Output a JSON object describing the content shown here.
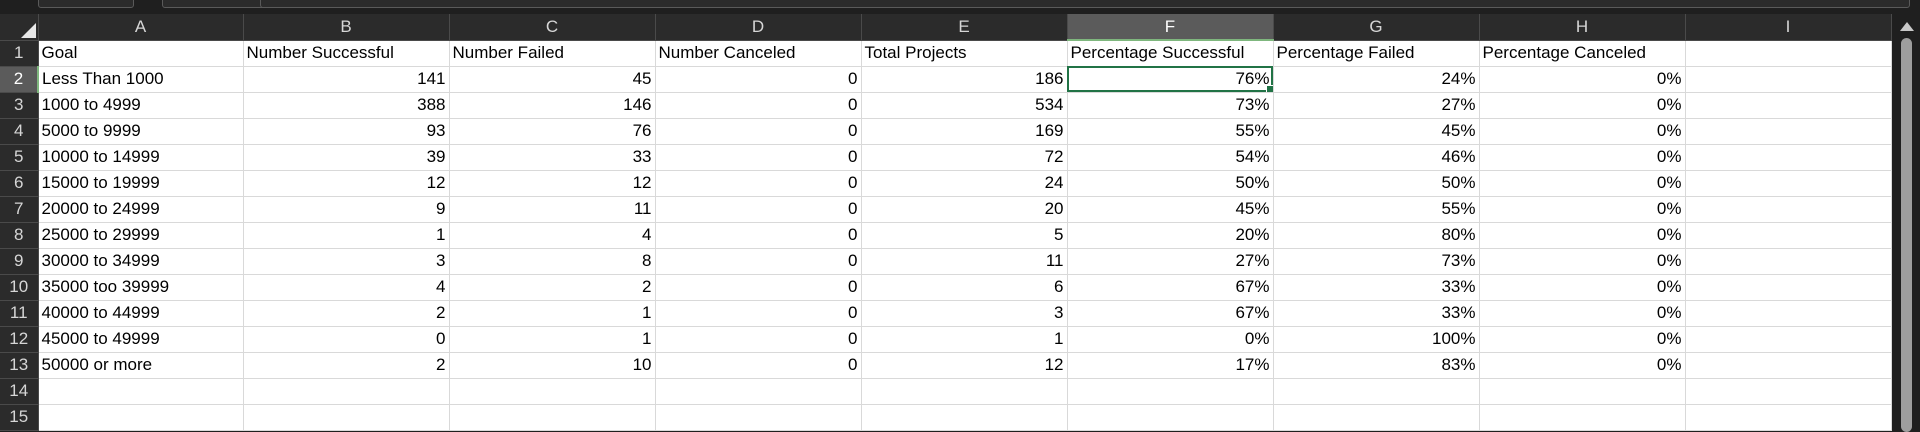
{
  "columns": [
    "A",
    "B",
    "C",
    "D",
    "E",
    "F",
    "G",
    "H",
    "I"
  ],
  "active_column": "F",
  "active_row": "2",
  "rows": [
    {
      "num": "1",
      "cells": [
        "Goal",
        "Number Successful",
        "Number Failed",
        "Number Canceled",
        "Total Projects",
        "Percentage Successful",
        "Percentage Failed",
        "Percentage Canceled",
        ""
      ]
    },
    {
      "num": "2",
      "cells": [
        "Less Than 1000",
        "141",
        "45",
        "0",
        "186",
        "76%",
        "24%",
        "0%",
        ""
      ]
    },
    {
      "num": "3",
      "cells": [
        "1000 to 4999",
        "388",
        "146",
        "0",
        "534",
        "73%",
        "27%",
        "0%",
        ""
      ]
    },
    {
      "num": "4",
      "cells": [
        "5000 to 9999",
        "93",
        "76",
        "0",
        "169",
        "55%",
        "45%",
        "0%",
        ""
      ]
    },
    {
      "num": "5",
      "cells": [
        "10000 to 14999",
        "39",
        "33",
        "0",
        "72",
        "54%",
        "46%",
        "0%",
        ""
      ]
    },
    {
      "num": "6",
      "cells": [
        "15000 to 19999",
        "12",
        "12",
        "0",
        "24",
        "50%",
        "50%",
        "0%",
        ""
      ]
    },
    {
      "num": "7",
      "cells": [
        "20000 to 24999",
        "9",
        "11",
        "0",
        "20",
        "45%",
        "55%",
        "0%",
        ""
      ]
    },
    {
      "num": "8",
      "cells": [
        "25000 to 29999",
        "1",
        "4",
        "0",
        "5",
        "20%",
        "80%",
        "0%",
        ""
      ]
    },
    {
      "num": "9",
      "cells": [
        "30000 to 34999",
        "3",
        "8",
        "0",
        "11",
        "27%",
        "73%",
        "0%",
        ""
      ]
    },
    {
      "num": "10",
      "cells": [
        "35000 too 39999",
        "4",
        "2",
        "0",
        "6",
        "67%",
        "33%",
        "0%",
        ""
      ]
    },
    {
      "num": "11",
      "cells": [
        "40000 to 44999",
        "2",
        "1",
        "0",
        "3",
        "67%",
        "33%",
        "0%",
        ""
      ]
    },
    {
      "num": "12",
      "cells": [
        "45000 to 49999",
        "0",
        "1",
        "0",
        "1",
        "0%",
        "100%",
        "0%",
        ""
      ]
    },
    {
      "num": "13",
      "cells": [
        "50000 or more",
        "2",
        "10",
        "0",
        "12",
        "17%",
        "83%",
        "0%",
        ""
      ]
    },
    {
      "num": "14",
      "cells": [
        "",
        "",
        "",
        "",
        "",
        "",
        "",
        "",
        ""
      ]
    },
    {
      "num": "15",
      "cells": [
        "",
        "",
        "",
        "",
        "",
        "",
        "",
        "",
        ""
      ]
    }
  ],
  "theme": {
    "header_bg": "#2b2b2b",
    "active_header_bg": "#5b5b5b",
    "selection_color": "#217346",
    "cell_bg": "#ffffff"
  }
}
